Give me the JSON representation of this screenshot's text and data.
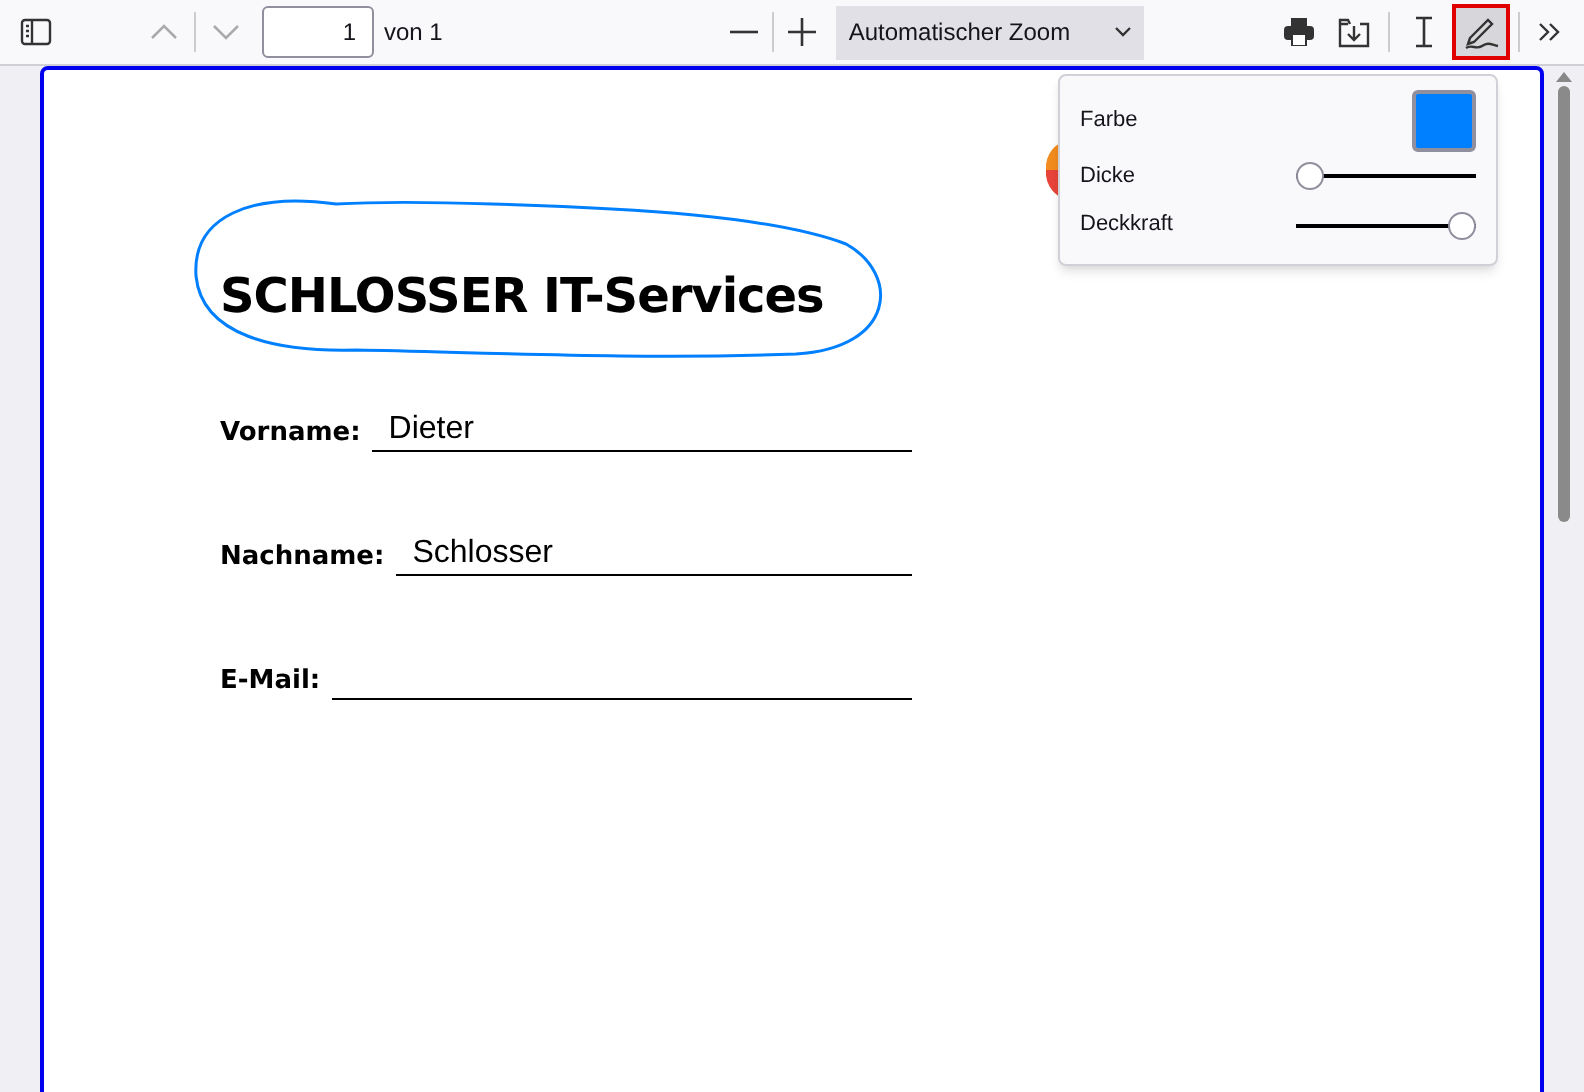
{
  "toolbar": {
    "page_number": "1",
    "page_count": "von 1",
    "zoom": "Automatischer Zoom",
    "draw_tool": {
      "selected": true
    }
  },
  "ink_popover": {
    "color_label": "Farbe",
    "color": "#0080ff",
    "thickness_label": "Dicke",
    "thickness": {
      "level": 0
    },
    "opacity_label": "Deckkraft",
    "opacity": {
      "level": 1
    }
  },
  "document": {
    "title": "SCHLOSSER IT-Services",
    "fields": [
      {
        "label": "Vorname:",
        "value": "Dieter"
      },
      {
        "label": "Nachname:",
        "value": "Schlosser"
      },
      {
        "label": "E-Mail:"
      }
    ]
  }
}
